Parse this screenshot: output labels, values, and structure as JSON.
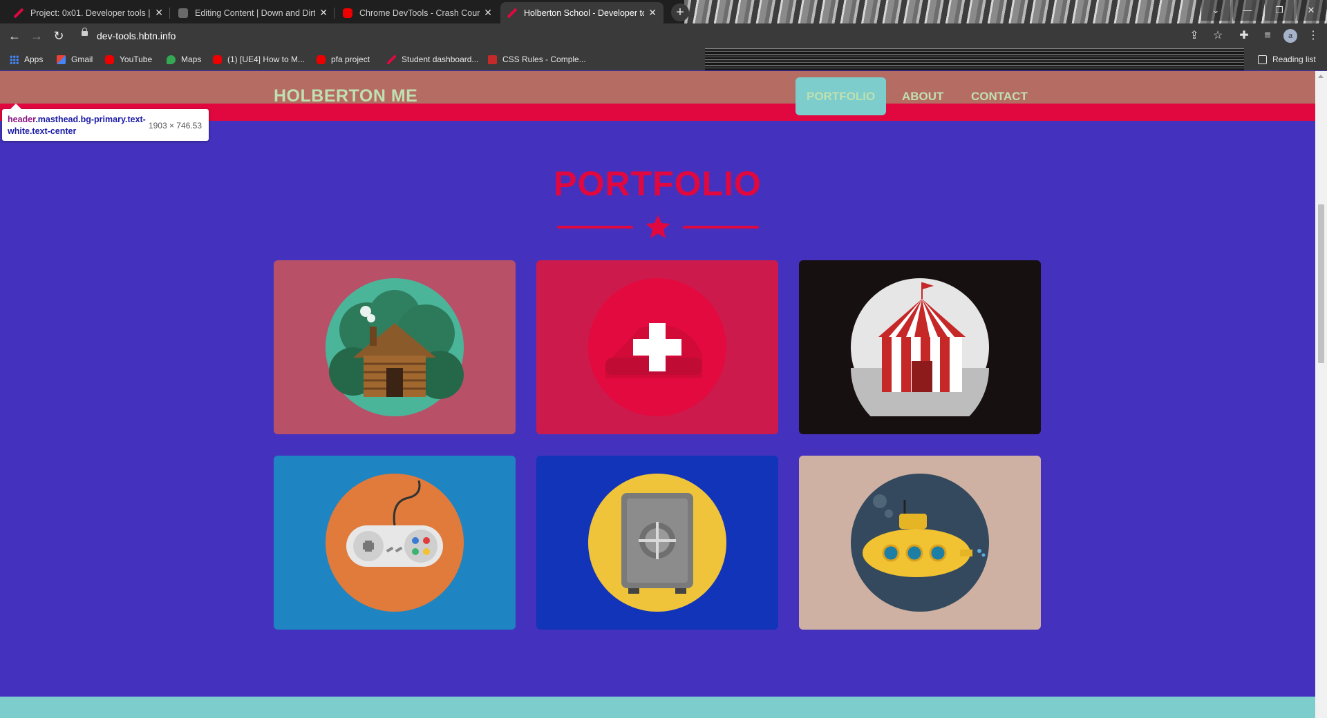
{
  "browser": {
    "tabs": [
      {
        "title": "Project: 0x01. Developer tools | H",
        "favicon": "holberton-icon",
        "active": false
      },
      {
        "title": "Editing Content | Down and Dirty",
        "favicon": "book-icon",
        "active": false
      },
      {
        "title": "Chrome DevTools - Crash Course",
        "favicon": "youtube-icon",
        "active": false
      },
      {
        "title": "Holberton School - Developer to",
        "favicon": "holberton-icon",
        "active": true
      }
    ],
    "new_tab": "+",
    "url": "dev-tools.hbtn.info",
    "profile_initial": "a",
    "bookmarks": [
      {
        "label": "Apps",
        "icon": "apps-grid-icon"
      },
      {
        "label": "Gmail",
        "icon": "gmail-icon"
      },
      {
        "label": "YouTube",
        "icon": "youtube-icon"
      },
      {
        "label": "Maps",
        "icon": "maps-icon"
      },
      {
        "label": "(1) [UE4] How to M...",
        "icon": "youtube-icon"
      },
      {
        "label": "pfa project",
        "icon": "youtube-icon"
      },
      {
        "label": "Student dashboard...",
        "icon": "holberton-icon"
      },
      {
        "label": "CSS Rules - Comple...",
        "icon": "codecademy-icon"
      }
    ],
    "reading_list": "Reading list"
  },
  "page": {
    "brand": "HOLBERTON ME",
    "nav": [
      {
        "label": "PORTFOLIO",
        "active": true
      },
      {
        "label": "ABOUT",
        "active": false
      },
      {
        "label": "CONTACT",
        "active": false
      }
    ],
    "tooltip": {
      "selector_tag": "header",
      "selector_classes": ".masthead.bg-primary.text-white.text-center",
      "size": "1903 × 746.53"
    },
    "portfolio_heading": "PORTFOLIO",
    "cards": [
      {
        "name": "cabin",
        "bg": "#b85068",
        "circle": "#4bb59a"
      },
      {
        "name": "cake",
        "bg": "#cd1a4d",
        "circle": "#e20a3f"
      },
      {
        "name": "circus",
        "bg": "#161010",
        "circle": "#e6e6e6"
      },
      {
        "name": "game",
        "bg": "#1e84c2",
        "circle": "#e07b3b"
      },
      {
        "name": "safe",
        "bg": "#1234b8",
        "circle": "#efc43a"
      },
      {
        "name": "submarine",
        "bg": "#ceb1a2",
        "circle": "#34495e"
      }
    ]
  },
  "colors": {
    "primary": "#e0083f",
    "section_bg": "#4432bf",
    "nav_bg": "#b56c63",
    "accent": "#7ccdcc",
    "nav_text": "#bfe0b0"
  }
}
